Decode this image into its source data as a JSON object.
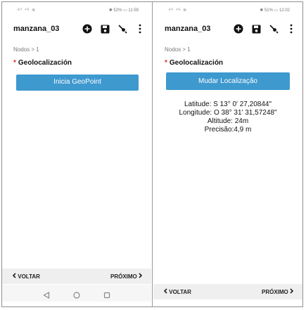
{
  "left": {
    "status_left": "ᵃᴵˡ ⁴ᴳ ≋",
    "status_right": "✱ 52% ▭ 11:59",
    "app_title": "manzana_03",
    "breadcrumb": "Nodos > 1",
    "required_mark": "*",
    "question": "Geolocalización",
    "button_label": "Inicia GeoPoint",
    "nav_back": "VOLTAR",
    "nav_next": "PRÓXIMO"
  },
  "right": {
    "status_left": "ᵃᴵˡ ⁴ᴳ ≋",
    "status_right": "✱ 51% ▭ 12:02",
    "app_title": "manzana_03",
    "breadcrumb": "Nodos > 1",
    "required_mark": "*",
    "question": "Geolocalización",
    "button_label": "Mudar Localização",
    "latitude": "Latitude: S 13° 0' 27,20844\"",
    "longitude": "Longitude: O 38° 31' 31,57248\"",
    "altitude": "Altitude: 24m",
    "precision": "Precisão:4,9 m",
    "nav_back": "VOLTAR",
    "nav_next": "PRÓXIMO"
  },
  "icons": [
    "add-icon",
    "save-icon",
    "gps-icon",
    "more-vert-icon",
    "chevron-left-icon",
    "chevron-right-icon",
    "back-triangle-icon",
    "home-circle-icon",
    "recents-square-icon"
  ],
  "colors": {
    "accent": "#3e99cf",
    "required": "#d93025",
    "navbar": "#efefef"
  }
}
